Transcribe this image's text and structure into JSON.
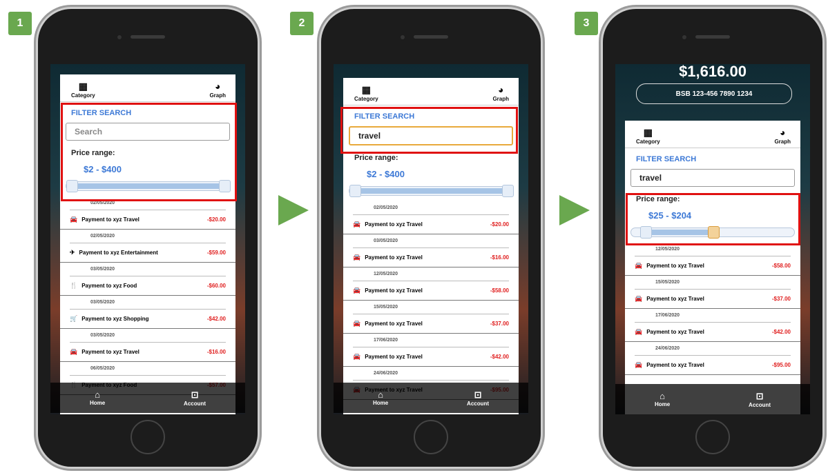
{
  "steps": [
    "1",
    "2",
    "3"
  ],
  "tabs": {
    "category": "Category",
    "graph": "Graph"
  },
  "nav": {
    "home": "Home",
    "account": "Account"
  },
  "filter_label": "FILTER SEARCH",
  "price_label": "Price range:",
  "screen1": {
    "search_placeholder": "Search",
    "price_value": "$2 - $400",
    "slider": {
      "min_fraction": 0.0,
      "max_fraction": 1.0
    },
    "transactions": [
      {
        "date": "02/05/2020",
        "label": "Payment to xyz Travel",
        "amount": "-$20.00",
        "icon": "car-icon"
      },
      {
        "date": "02/05/2020",
        "label": "Payment to xyz Entertainment",
        "amount": "-$59.00",
        "icon": "rocket-icon"
      },
      {
        "date": "03/05/2020",
        "label": "Payment to xyz Food",
        "amount": "-$60.00",
        "icon": "utensils-icon"
      },
      {
        "date": "03/05/2020",
        "label": "Payment to xyz Shopping",
        "amount": "-$42.00",
        "icon": "cart-icon"
      },
      {
        "date": "03/05/2020",
        "label": "Payment to xyz Travel",
        "amount": "-$16.00",
        "icon": "car-icon"
      },
      {
        "date": "06/05/2020",
        "label": "Payment to xyz Food",
        "amount": "-$57.00",
        "icon": "utensils-icon"
      }
    ]
  },
  "screen2": {
    "search_value": "travel",
    "price_value": "$2 - $400",
    "slider": {
      "min_fraction": 0.0,
      "max_fraction": 1.0
    },
    "transactions": [
      {
        "date": "02/05/2020",
        "label": "Payment to xyz Travel",
        "amount": "-$20.00",
        "icon": "car-icon"
      },
      {
        "date": "03/05/2020",
        "label": "Payment to xyz Travel",
        "amount": "-$16.00",
        "icon": "car-icon"
      },
      {
        "date": "12/05/2020",
        "label": "Payment to xyz Travel",
        "amount": "-$58.00",
        "icon": "car-icon"
      },
      {
        "date": "15/05/2020",
        "label": "Payment to xyz Travel",
        "amount": "-$37.00",
        "icon": "car-icon"
      },
      {
        "date": "17/06/2020",
        "label": "Payment to xyz Travel",
        "amount": "-$42.00",
        "icon": "car-icon"
      },
      {
        "date": "24/06/2020",
        "label": "Payment to xyz Travel",
        "amount": "-$95.00",
        "icon": "car-icon"
      }
    ]
  },
  "screen3": {
    "balance": "$1,616.00",
    "bsb": "BSB 123-456 7890 1234",
    "search_value": "travel",
    "price_value": "$25 - $204",
    "slider": {
      "min_fraction": 0.06,
      "max_fraction": 0.5
    },
    "transactions": [
      {
        "date": "12/05/2020",
        "label": "Payment to xyz Travel",
        "amount": "-$58.00",
        "icon": "car-icon"
      },
      {
        "date": "15/05/2020",
        "label": "Payment to xyz Travel",
        "amount": "-$37.00",
        "icon": "car-icon"
      },
      {
        "date": "17/06/2020",
        "label": "Payment to xyz Travel",
        "amount": "-$42.00",
        "icon": "car-icon"
      },
      {
        "date": "24/06/2020",
        "label": "Payment to xyz Travel",
        "amount": "-$95.00",
        "icon": "car-icon"
      }
    ]
  },
  "colors": {
    "accent_blue": "#3d79d6",
    "amount_red": "#e02020",
    "highlight_red": "#e01010",
    "step_green": "#6aa84f"
  }
}
